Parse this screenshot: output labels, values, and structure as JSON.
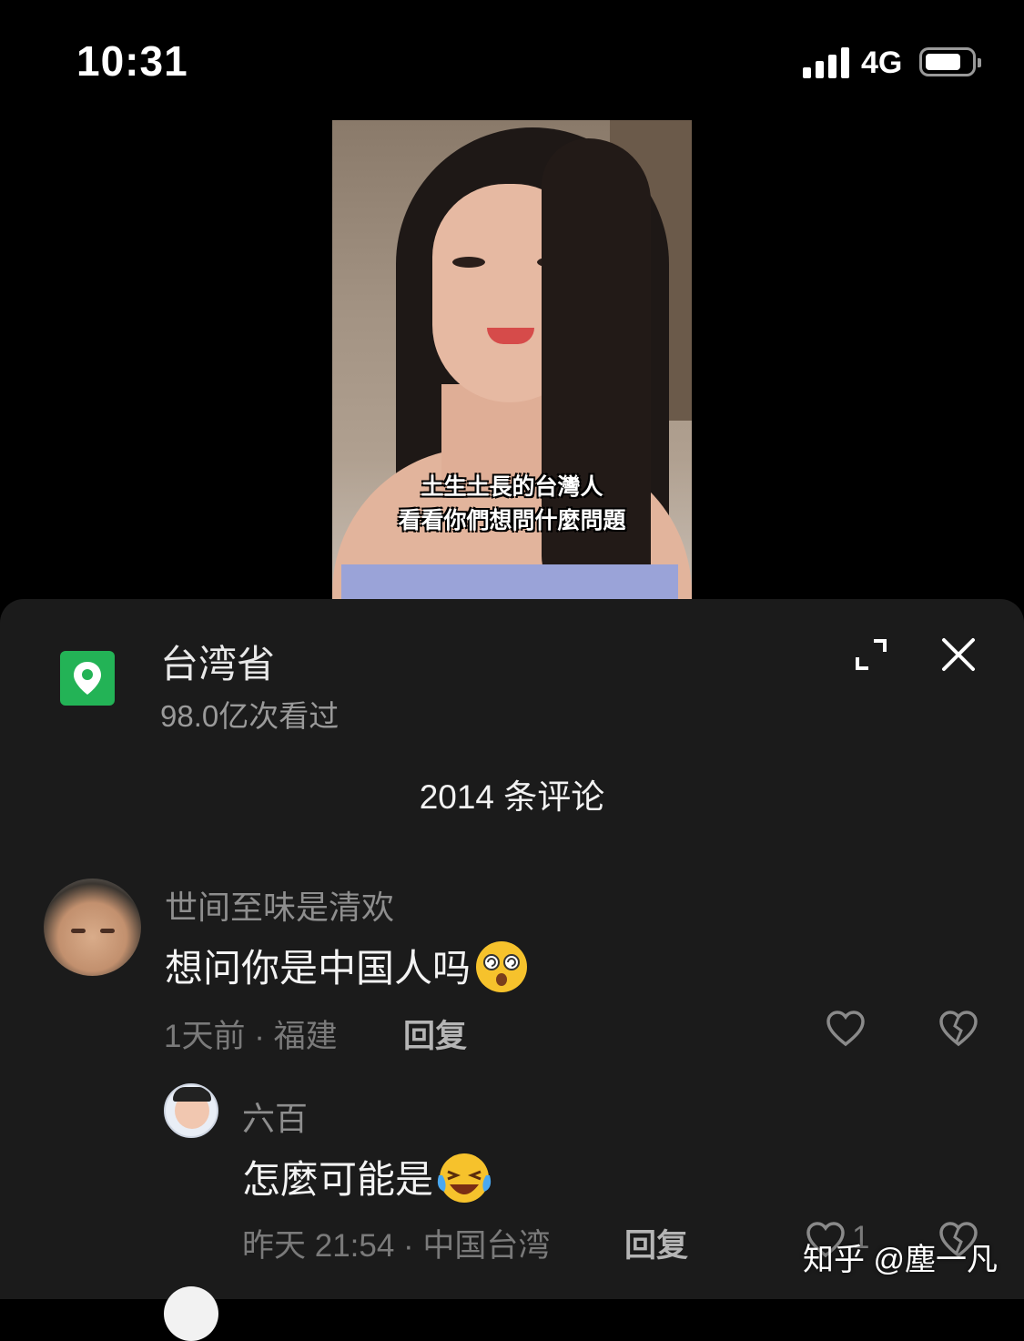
{
  "status_bar": {
    "time": "10:31",
    "network": "4G"
  },
  "video": {
    "caption_line1": "土生土長的台灣人",
    "caption_line2": "看看你們想問什麼問題"
  },
  "location": {
    "title": "台湾省",
    "views": "98.0亿次看过",
    "icon": "location-pin-icon"
  },
  "comments_header": {
    "count_label": "2014 条评论"
  },
  "comments": [
    {
      "username": "世间至味是清欢",
      "text": "想问你是中国人吗",
      "emoji": "dizzy-face-emoji",
      "meta": "1天前 · 福建",
      "reply_label": "回复"
    },
    {
      "username": "六百",
      "text": "怎麼可能是",
      "emoji": "crying-laughing-emoji",
      "meta": "昨天 21:54 · 中国台湾",
      "reply_label": "回复",
      "like_count": "1"
    }
  ],
  "watermark": "知乎 @塵一凡",
  "colors": {
    "sheet_bg": "#1b1b1b",
    "location_green": "#23b356",
    "muted_text": "#8e8e8e"
  }
}
